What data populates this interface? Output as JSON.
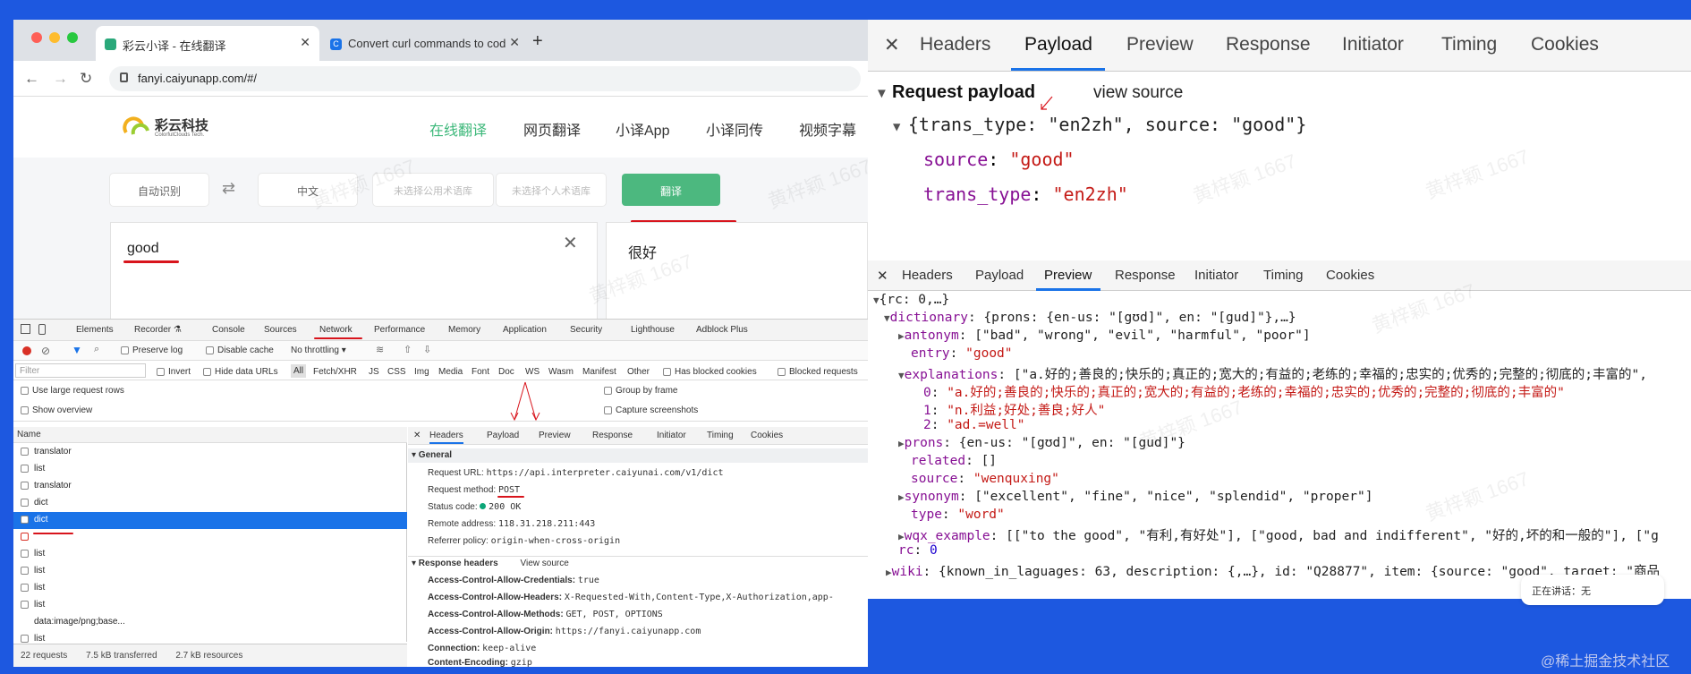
{
  "browser": {
    "tabs": [
      {
        "title": "彩云小译 - 在线翻译",
        "close": "✕"
      },
      {
        "title": "Convert curl commands to cod",
        "close": "✕"
      }
    ],
    "new_tab": "+",
    "url": "fanyi.caiyunapp.com/#/"
  },
  "site": {
    "logo_title": "彩云科技",
    "logo_subtitle": "ColorfulClouds Tech.",
    "nav": [
      "在线翻译",
      "网页翻译",
      "小译App",
      "小译同传",
      "视频字幕"
    ],
    "source_lang": "自动识别",
    "swap": "⇄",
    "target_lang": "中文",
    "public_glossary": "未选择公用术语库",
    "personal_glossary": "未选择个人术语库",
    "translate_button": "翻译",
    "input_text": "good",
    "clear": "✕",
    "output_text": "很好",
    "watermark": "黄梓颖 1667"
  },
  "devtools_small": {
    "tabs": [
      "Elements",
      "Recorder ⚗",
      "Console",
      "Sources",
      "Network",
      "Performance",
      "Memory",
      "Application",
      "Security",
      "Lighthouse",
      "Adblock Plus"
    ],
    "preserve_log": "Preserve log",
    "disable_cache": "Disable cache",
    "throttling": "No throttling",
    "filter_placeholder": "Filter",
    "invert": "Invert",
    "hide_data_urls": "Hide data URLs",
    "types": [
      "All",
      "Fetch/XHR",
      "JS",
      "CSS",
      "Img",
      "Media",
      "Font",
      "Doc",
      "WS",
      "Wasm",
      "Manifest",
      "Other"
    ],
    "has_blocked_cookies": "Has blocked cookies",
    "blocked_requests": "Blocked requests",
    "use_large_rows": "Use large request rows",
    "group_by_frame": "Group by frame",
    "show_overview": "Show overview",
    "capture_screenshots": "Capture screenshots",
    "name_header": "Name",
    "requests": [
      "translator",
      "list",
      "translator",
      "dict",
      "dict",
      "",
      "list",
      "list",
      "list",
      "list",
      "data:image/png;base...",
      "list",
      "list"
    ],
    "detail_tabs": [
      "✕",
      "Headers",
      "Payload",
      "Preview",
      "Response",
      "Initiator",
      "Timing",
      "Cookies"
    ],
    "general_title": "▾ General",
    "request_url_label": "Request URL:",
    "request_url": "https://api.interpreter.caiyunai.com/v1/dict",
    "request_method_label": "Request method:",
    "request_method": "POST",
    "status_code_label": "Status code:",
    "status_code": "200 OK",
    "remote_address_label": "Remote address:",
    "remote_address": "118.31.218.211:443",
    "referrer_policy_label": "Referrer policy:",
    "referrer_policy": "origin-when-cross-origin",
    "response_headers_title": "▾ Response headers",
    "view_source": "View source",
    "headers": [
      {
        "k": "Access-Control-Allow-Credentials:",
        "v": "true"
      },
      {
        "k": "Access-Control-Allow-Headers:",
        "v": "X-Requested-With,Content-Type,X-Authorization,app-"
      },
      {
        "k": "Access-Control-Allow-Methods:",
        "v": "GET, POST, OPTIONS"
      },
      {
        "k": "Access-Control-Allow-Origin:",
        "v": "https://fanyi.caiyunapp.com"
      },
      {
        "k": "Connection:",
        "v": "keep-alive"
      },
      {
        "k": "Content-Encoding:",
        "v": "gzip"
      }
    ],
    "status_requests": "22 requests",
    "status_transferred": "7.5 kB transferred",
    "status_resources": "2.7 kB resources"
  },
  "payload_panel": {
    "tabs": [
      "✕",
      "Headers",
      "Payload",
      "Preview",
      "Response",
      "Initiator",
      "Timing",
      "Cookies"
    ],
    "section_title": "Request payload",
    "view_source": "view source",
    "object_summary": "{trans_type: \"en2zh\", source: \"good\"}",
    "source_key": "source",
    "source_value": "\"good\"",
    "trans_type_key": "trans_type",
    "trans_type_value": "\"en2zh\""
  },
  "preview_panel": {
    "tabs": [
      "✕",
      "Headers",
      "Payload",
      "Preview",
      "Response",
      "Initiator",
      "Timing",
      "Cookies"
    ],
    "lines": {
      "root": "{rc: 0,…}",
      "dictionary": "{prons: {en-us: \"[gʊd]\", en: \"[gud]\"},…}",
      "antonym": "[\"bad\", \"wrong\", \"evil\", \"harmful\", \"poor\"]",
      "entry": "\"good\"",
      "explanations": "[\"a.好的;善良的;快乐的;真正的;宽大的;有益的;老练的;幸福的;忠实的;优秀的;完整的;彻底的;丰富的\",",
      "exp0": "\"a.好的;善良的;快乐的;真正的;宽大的;有益的;老练的;幸福的;忠实的;优秀的;完整的;彻底的;丰富的\"",
      "exp1": "\"n.利益;好处;善良;好人\"",
      "exp2": "\"ad.=well\"",
      "prons": "{en-us: \"[gʊd]\", en: \"[gud]\"}",
      "related": "[]",
      "source": "\"wenquxing\"",
      "synonym": "[\"excellent\", \"fine\", \"nice\", \"splendid\", \"proper\"]",
      "type": "\"word\"",
      "wqx_example": "[[\"to the good\", \"有利,有好处\"], [\"good, bad and indifferent\", \"好的,坏的和一般的\"], [\"g",
      "rc": "0",
      "wiki": "{known_in_laguages: 63, description: {,…}, id: \"Q28877\", item: {source: \"good\", target: \"商品"
    },
    "keys": {
      "dictionary": "dictionary",
      "antonym": "antonym",
      "entry": "entry",
      "explanations": "explanations",
      "i0": "0",
      "i1": "1",
      "i2": "2",
      "prons": "prons",
      "related": "related",
      "source": "source",
      "synonym": "synonym",
      "type": "type",
      "wqx_example": "wqx_example",
      "rc": "rc",
      "wiki": "wiki"
    }
  },
  "overlay": {
    "speaking": "正在讲话：无",
    "credit": "@稀土掘金技术社区"
  }
}
